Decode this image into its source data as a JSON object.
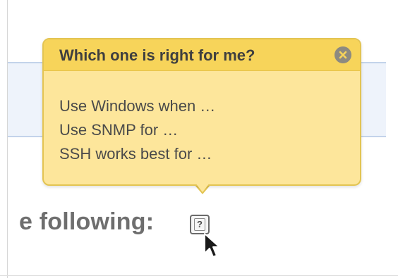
{
  "tooltip": {
    "title": "Which one is right for me?",
    "lines": [
      "Use Windows when …",
      "Use SNMP for …",
      "SSH works best for …"
    ],
    "close_icon": "close-circle-icon"
  },
  "form": {
    "label": "e following:",
    "help_button_label": "?",
    "help_icon": "question-mark-icon"
  },
  "cursor": {
    "icon": "mouse-pointer-icon"
  },
  "colors": {
    "tooltip_background": "#fde69b",
    "tooltip_header": "#f7d45a",
    "tooltip_border": "#e3c452",
    "panel_background": "#eef3fb",
    "label_text": "#6e6e6e"
  }
}
